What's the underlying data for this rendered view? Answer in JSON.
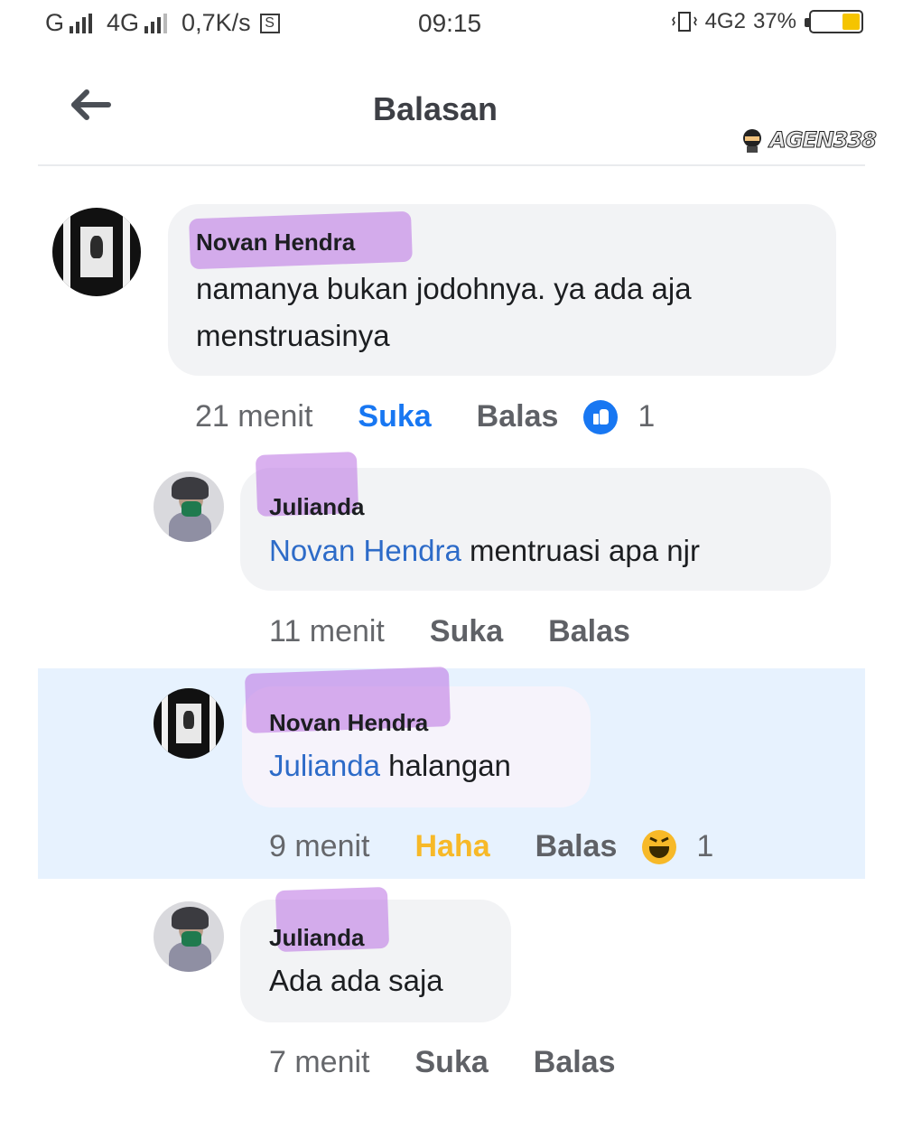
{
  "status_bar": {
    "network_1": "G",
    "network_2": "4G",
    "speed": "0,7K/s",
    "speed_icon": "S",
    "time": "09:15",
    "network_3": "4G2",
    "battery_percent": "37%",
    "battery_level": 0.37,
    "battery_color": "#f5c400"
  },
  "header": {
    "back_icon": "arrow-left-icon",
    "title": "Balasan",
    "watermark": "AGEN338"
  },
  "comments": [
    {
      "author": "Novan Hendra",
      "text": "namanya bukan jodohnya. ya ada aja menstruasinya",
      "text_line_1": "namanya bukan jodohnya. ya ada aja",
      "text_line_2": "menstruasinya",
      "time": "21 menit",
      "reaction_action": "Suka",
      "reply_action": "Balas",
      "reaction_count": "1",
      "reaction_icon": "like-icon"
    },
    {
      "author": "Julianda",
      "mention": "Novan Hendra",
      "text": "mentruasi apa njr",
      "time": "11 menit",
      "reaction_action": "Suka",
      "reply_action": "Balas"
    },
    {
      "author": "Novan Hendra",
      "mention": "Julianda",
      "text": "halangan",
      "time": "9 menit",
      "reaction_action": "Haha",
      "reply_action": "Balas",
      "reaction_count": "1",
      "reaction_icon": "haha-icon"
    },
    {
      "author": "Julianda",
      "text": "Ada ada saja",
      "time": "7 menit",
      "reaction_action": "Suka",
      "reply_action": "Balas"
    }
  ],
  "colors": {
    "link_blue": "#2d6bc8",
    "like_blue": "#1877f2",
    "haha_yellow": "#f7b928",
    "highlight_bg": "#e7f2fe",
    "name_highlight": "#ba70e2"
  }
}
